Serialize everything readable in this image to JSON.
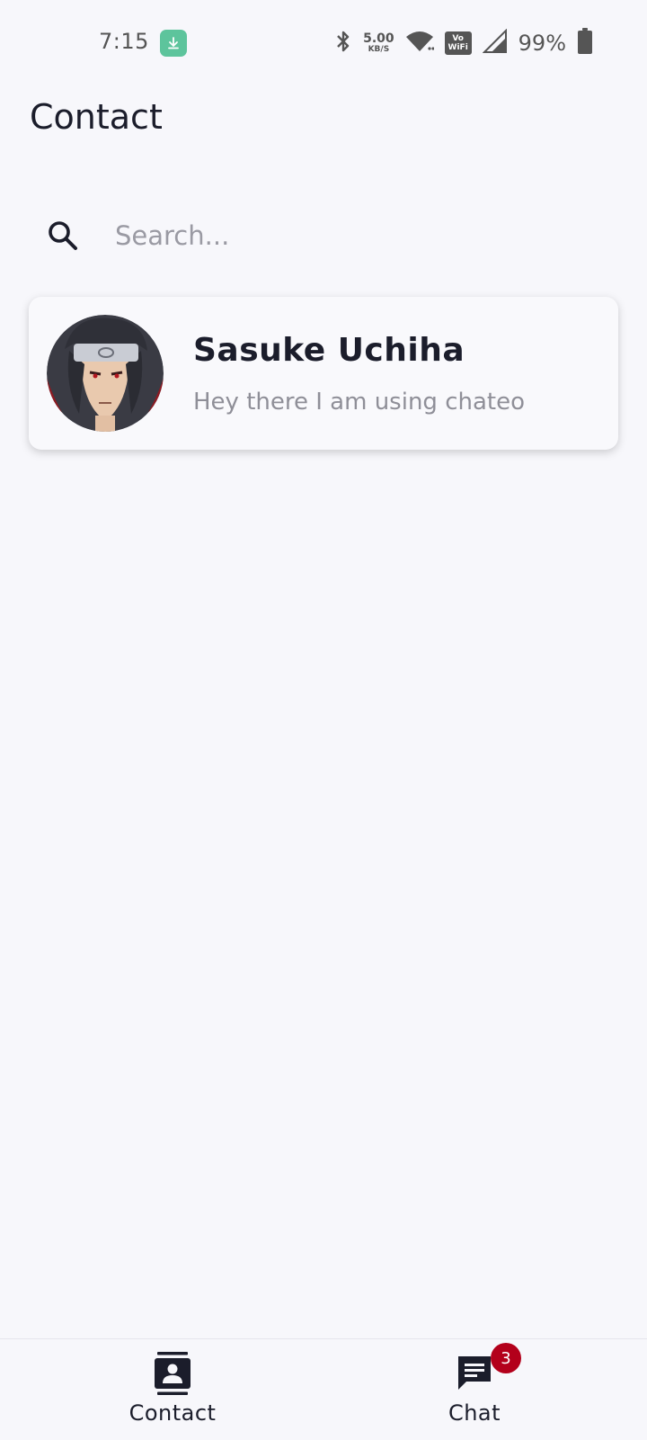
{
  "status_bar": {
    "time": "7:15",
    "net_speed_value": "5.00",
    "net_speed_unit": "KB/S",
    "vowifi_top": "Vo",
    "vowifi_bottom": "WiFi",
    "battery": "99%",
    "icons": [
      "download-icon",
      "bluetooth-icon",
      "wifi-icon",
      "vowifi-icon",
      "cellular-signal-icon",
      "battery-icon"
    ],
    "download_badge_color": "#5dc49c"
  },
  "header": {
    "title": "Contact"
  },
  "search": {
    "placeholder": "Search...",
    "value": ""
  },
  "contacts": [
    {
      "name": "Sasuke Uchiha",
      "status": "Hey there I am using chateo"
    }
  ],
  "bottom_nav": {
    "items": [
      {
        "label": "Contact",
        "icon": "contact-book-icon",
        "active": true
      },
      {
        "label": "Chat",
        "icon": "chat-bubble-icon",
        "badge": "3"
      }
    ],
    "badge_color": "#b3001b"
  }
}
